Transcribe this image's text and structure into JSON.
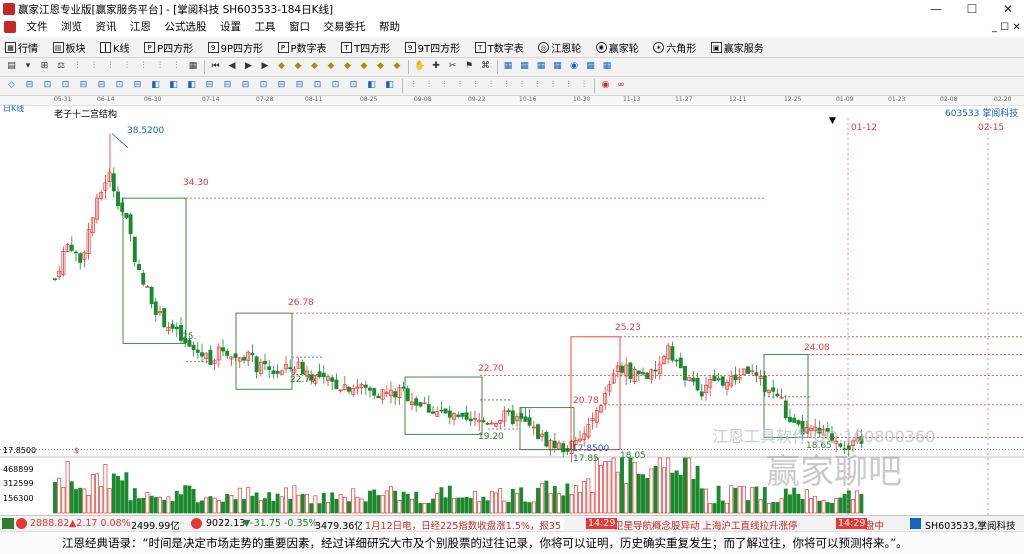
{
  "window": {
    "title": "赢家江恩专业版[赢家服务平台] - [掌阅科技  SH603533-184日K线]",
    "min": "—",
    "max": "☐",
    "close": "✕"
  },
  "menu": [
    "文件",
    "浏览",
    "资讯",
    "江恩",
    "公式选股",
    "设置",
    "工具",
    "窗口",
    "交易委托",
    "帮助"
  ],
  "menu_right": "_ ☐ ✕",
  "toolbar1": [
    {
      "label": "行情",
      "icon": "grid-icon"
    },
    {
      "label": "板块",
      "icon": "blocks-icon"
    },
    {
      "label": "K线",
      "icon": "candle-icon"
    },
    {
      "label": "P四方形",
      "icon": "p-square-icon"
    },
    {
      "label": "9P四方形",
      "icon": "9p-square-icon"
    },
    {
      "label": "P数字表",
      "icon": "p-table-icon"
    },
    {
      "label": "T四方形",
      "icon": "t-square-icon"
    },
    {
      "label": "9T四方形",
      "icon": "9t-square-icon"
    },
    {
      "label": "T数字表",
      "icon": "t-table-icon"
    },
    {
      "label": "江恩轮",
      "icon": "gann-wheel-icon"
    },
    {
      "label": "赢家轮",
      "icon": "winner-wheel-icon"
    },
    {
      "label": "六角形",
      "icon": "hexagon-icon"
    },
    {
      "label": "赢家服务",
      "icon": "service-icon"
    }
  ],
  "chart_header": {
    "period": "日K线",
    "code_name": "603533  掌阅科技",
    "structure_label": "老子十二宫结构"
  },
  "date_ticks": [
    "05-31",
    "06-14",
    "06-30",
    "07-14",
    "07-28",
    "08-11",
    "08-25",
    "09-08",
    "09-22",
    "10-16",
    "10-30",
    "11-13",
    "11-27",
    "12-11",
    "12-25",
    "01-09",
    "01-23",
    "02-08",
    "02-20"
  ],
  "vlines": [
    "01-12",
    "02-15"
  ],
  "price_labels": {
    "high": "38.5200",
    "p34": "34.30",
    "p25": "25.",
    "p26": "26.78",
    "p2276": "22.76",
    "p2270": "22.70",
    "p1920": "19.20",
    "p2523": "25.23",
    "p2078": "20.78",
    "p1785": "17.85",
    "p1785b": "17.8500",
    "p2408": "24.08",
    "p1865": "18.65",
    "p1805": "18.05",
    "axis": "17.8500",
    "dollar": "$"
  },
  "volume_axis": [
    "468899",
    "312599",
    "156300"
  ],
  "watermark": {
    "contact": "江恩工具软件 QQ:100800360",
    "brand": "赢家聊吧"
  },
  "status": {
    "sh_index": "2888.82",
    "sh_change": "▲2.17 0.08%",
    "sh_amount": "2499.99亿",
    "sz_index": "9022.13",
    "sz_change": "▼-31.75 -0.35%",
    "sz_amount": "3479.36亿",
    "news": "1月12日电，日经225指数收盘涨1.5%，报35",
    "time1": "14:29",
    "news2": "卫星导航概念股异动 上海沪工直线拉升涨停",
    "time2": "14:29",
    "market": "盘中",
    "right": "SH603533,掌阅科技"
  },
  "quote": "江恩经典语录：“时间是决定市场走势的重要因素，经过详细研究大市及个别股票的过往记录，你将可以证明，历史确实重复发生；而了解过往，你将可以预测将来。”。",
  "chart_data": {
    "type": "candlestick",
    "period": "日K线",
    "y_range": [
      17.5,
      40
    ],
    "ohlc": [],
    "levels": [
      34.3,
      26.78,
      22.7,
      25.23,
      24.08,
      20.78,
      19.2,
      22.76,
      17.85,
      18.65,
      18.05
    ],
    "high_label": 38.52,
    "low_label": 17.85
  }
}
